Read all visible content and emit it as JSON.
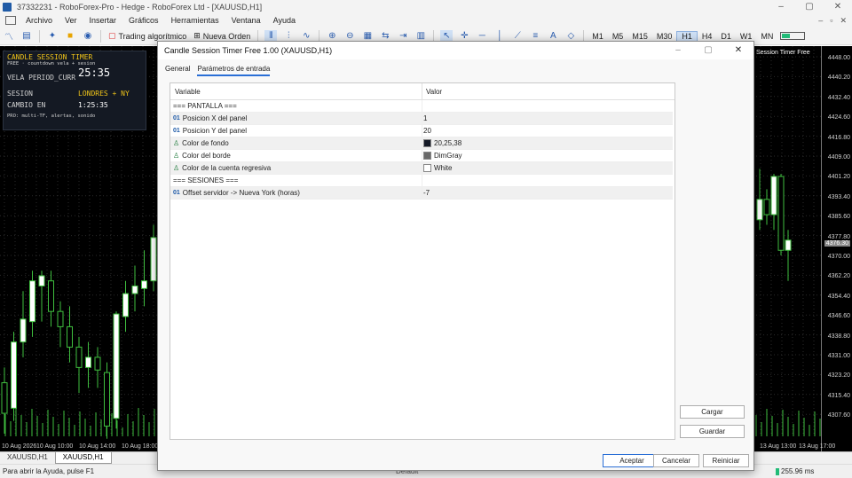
{
  "window": {
    "title": "37332231 - RoboForex-Pro - Hedge - RoboForex Ltd - [XAUUSD,H1]",
    "controls": [
      "–",
      "▢",
      "✕"
    ]
  },
  "menu": {
    "items": [
      "Archivo",
      "Ver",
      "Insertar",
      "Gráficos",
      "Herramientas",
      "Ventana",
      "Ayuda"
    ],
    "mdi_controls": [
      "–",
      "▫",
      "✕"
    ]
  },
  "toolbar": {
    "algo_trading": "Trading algorítmico",
    "new_order": "Nueva Orden",
    "timeframes": [
      "M1",
      "M5",
      "M15",
      "M30",
      "H1",
      "H4",
      "D1",
      "W1",
      "MN"
    ],
    "active_timeframe": "H1"
  },
  "chart": {
    "symbol": "XAUUSD,H1",
    "indicator_label": "Session Timer Free",
    "price_ticks": [
      "4448.00",
      "4440.20",
      "4432.40",
      "4424.60",
      "4416.80",
      "4409.00",
      "4401.20",
      "4393.40",
      "4385.60",
      "4377.80",
      "4370.00",
      "4362.20",
      "4354.40",
      "4346.60",
      "4338.80",
      "4331.00",
      "4323.20",
      "4315.40",
      "4307.60"
    ],
    "current_price": "4376.30",
    "time_ticks_left": [
      "10 Aug 2026",
      "10 Aug 10:00",
      "10 Aug 14:00",
      "10 Aug 18:00"
    ],
    "time_ticks_right": [
      "13 Aug 13:00",
      "13 Aug 17:00"
    ],
    "bull_color": "#ffffff",
    "bear_color": "#000000",
    "wick_color": "#3fbf3f"
  },
  "timer_panel": {
    "title": "CANDLE SESSION TIMER",
    "subtitle": "FREE · countdown vela + sesion",
    "vela_label": "VELA PERIOD_CURR",
    "vela_value": "25:35",
    "sesion_label": "SESION",
    "sesion_value": "LONDRES + NY",
    "cambio_label": "CAMBIO EN",
    "cambio_value": "1:25:35",
    "pro_note": "PRO: multi-TF, alertas, sonido",
    "title_color": "#f0c419",
    "session_color": "#f0c419",
    "bg_color": "#141923"
  },
  "dialog": {
    "title": "Candle Session Timer Free 1.00 (XAUUSD,H1)",
    "tabs": [
      "General",
      "Parámetros de entrada"
    ],
    "active_tab": "Parámetros de entrada",
    "columns": [
      "Variable",
      "Valor"
    ],
    "rows": [
      {
        "type": "",
        "name": "=== PANTALLA ===",
        "value": "",
        "swatch": ""
      },
      {
        "type": "01",
        "name": "Posicion X del panel",
        "value": "1",
        "swatch": ""
      },
      {
        "type": "01",
        "name": "Posicion Y del panel",
        "value": "20",
        "swatch": ""
      },
      {
        "type": "color",
        "name": "Color de fondo",
        "value": "20,25,38",
        "swatch": "#141926"
      },
      {
        "type": "color",
        "name": "Color del borde",
        "value": "DimGray",
        "swatch": "#696969"
      },
      {
        "type": "color",
        "name": "Color de la cuenta regresiva",
        "value": "White",
        "swatch": "#ffffff"
      },
      {
        "type": "",
        "name": "=== SESIONES ===",
        "value": "",
        "swatch": ""
      },
      {
        "type": "01",
        "name": "Offset servidor -> Nueva York (horas)",
        "value": "-7",
        "swatch": ""
      }
    ],
    "side_buttons": [
      "Cargar",
      "Guardar"
    ],
    "footer_buttons": [
      "Aceptar",
      "Cancelar",
      "Reiniciar"
    ]
  },
  "bottom_tabs": [
    "XAUUSD,H1",
    "XAUUSD,H1"
  ],
  "active_bottom_tab": 1,
  "status": {
    "help": "Para abrir la Ayuda, pulse F1",
    "profile": "Default",
    "ping": "255.96 ms"
  },
  "candles_left": [
    {
      "o": 4320,
      "c": 4308,
      "h": 4326,
      "l": 4300
    },
    {
      "o": 4310,
      "c": 4336,
      "h": 4340,
      "l": 4305
    },
    {
      "o": 4336,
      "c": 4345,
      "h": 4356,
      "l": 4330
    },
    {
      "o": 4344,
      "c": 4360,
      "h": 4364,
      "l": 4338
    },
    {
      "o": 4358,
      "c": 4362,
      "h": 4364,
      "l": 4344
    },
    {
      "o": 4360,
      "c": 4348,
      "h": 4364,
      "l": 4342
    },
    {
      "o": 4348,
      "c": 4342,
      "h": 4352,
      "l": 4334
    },
    {
      "o": 4342,
      "c": 4334,
      "h": 4350,
      "l": 4328
    },
    {
      "o": 4334,
      "c": 4326,
      "h": 4338,
      "l": 4316
    },
    {
      "o": 4326,
      "c": 4330,
      "h": 4336,
      "l": 4318
    },
    {
      "o": 4330,
      "c": 4325,
      "h": 4334,
      "l": 4318
    },
    {
      "o": 4324,
      "c": 4303,
      "h": 4328,
      "l": 4298
    },
    {
      "o": 4306,
      "c": 4347,
      "h": 4348,
      "l": 4302
    },
    {
      "o": 4346,
      "c": 4355,
      "h": 4360,
      "l": 4340
    },
    {
      "o": 4355,
      "c": 4358,
      "h": 4366,
      "l": 4348
    },
    {
      "o": 4357,
      "c": 4360,
      "h": 4372,
      "l": 4350
    },
    {
      "o": 4360,
      "c": 4377,
      "h": 4382,
      "l": 4356
    }
  ],
  "candles_right": [
    {
      "o": 4384,
      "c": 4392,
      "h": 4404,
      "l": 4380
    },
    {
      "o": 4392,
      "c": 4386,
      "h": 4396,
      "l": 4382
    },
    {
      "o": 4386,
      "c": 4401,
      "h": 4402,
      "l": 4380
    },
    {
      "o": 4401,
      "c": 4372,
      "h": 4402,
      "l": 4370
    },
    {
      "o": 4372,
      "c": 4376,
      "h": 4380,
      "l": 4360
    }
  ]
}
